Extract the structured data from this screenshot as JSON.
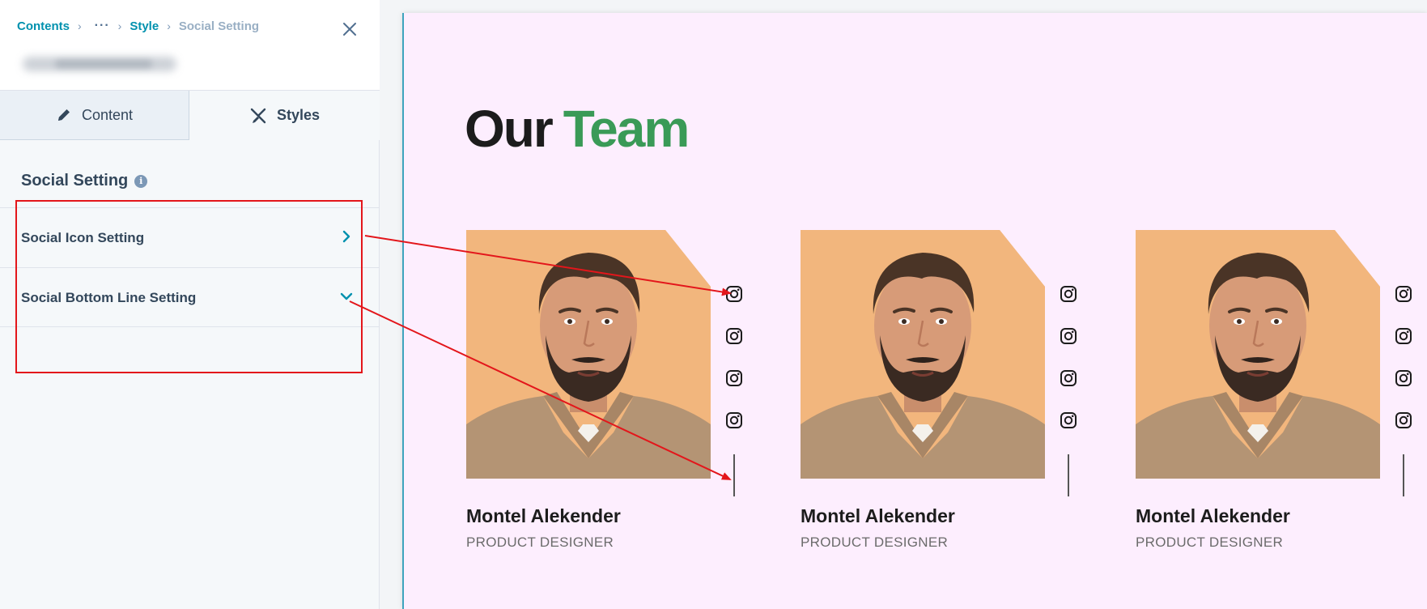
{
  "breadcrumb": {
    "items": [
      "Contents",
      "Style"
    ],
    "current": "Social Setting",
    "ellipsis": "···"
  },
  "tabs": {
    "content_label": "Content",
    "styles_label": "Styles",
    "active": "Styles"
  },
  "section": {
    "title": "Social Setting",
    "info_icon_glyph": "i"
  },
  "settings_rows": [
    {
      "label": "Social Icon Setting",
      "state": "collapsed"
    },
    {
      "label": "Social Bottom Line Setting",
      "state": "expanded"
    }
  ],
  "preview": {
    "heading_part1": "Our",
    "heading_part2": "Team",
    "accent_color": "#3a9a57",
    "background_color": "#fdeefe",
    "members": [
      {
        "name": "Montel Alekender",
        "role": "PRODUCT DESIGNER",
        "social_icons": [
          "instagram-icon",
          "instagram-icon",
          "instagram-icon",
          "instagram-icon"
        ]
      },
      {
        "name": "Montel Alekender",
        "role": "PRODUCT DESIGNER",
        "social_icons": [
          "instagram-icon",
          "instagram-icon",
          "instagram-icon",
          "instagram-icon"
        ]
      },
      {
        "name": "Montel Alekender",
        "role": "PRODUCT DESIGNER",
        "social_icons": [
          "instagram-icon",
          "instagram-icon",
          "instagram-icon",
          "instagram-icon"
        ]
      }
    ]
  },
  "annotation_color": "#e3161b"
}
